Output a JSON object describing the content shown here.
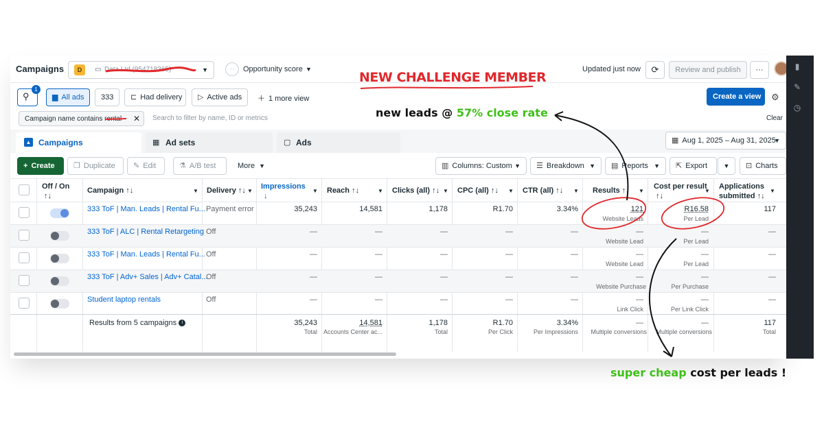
{
  "header": {
    "title": "Campaigns",
    "account_badge": "D",
    "account_name": "Data Ltd (954718365)",
    "opportunity_score": "Opportunity score",
    "updated": "Updated just now",
    "review_publish": "Review and publish",
    "more": "···"
  },
  "filters": {
    "search_badge": "1",
    "all_ads": "All ads",
    "view_333": "333",
    "had_delivery": "Had delivery",
    "active_ads": "Active ads",
    "more_view": "1 more view",
    "create_view": "Create a view",
    "chip_label": "Campaign name contains rental",
    "search_placeholder": "Search to filter by name, ID or metrics",
    "clear": "Clear"
  },
  "tabs": {
    "campaigns": "Campaigns",
    "adsets": "Ad sets",
    "ads": "Ads",
    "date_range": "Aug 1, 2025 – Aug 31, 2025"
  },
  "toolbar": {
    "create": "Create",
    "duplicate": "Duplicate",
    "edit": "Edit",
    "ab_test": "A/B test",
    "more": "More",
    "columns": "Columns: Custom",
    "breakdown": "Breakdown",
    "reports": "Reports",
    "export": "Export",
    "charts": "Charts"
  },
  "columns": {
    "offon": "Off / On",
    "offon_sort": "↑↓",
    "campaign": "Campaign ↑↓",
    "delivery": "Delivery ↑↓",
    "impressions": "Impressions",
    "impressions_sort": "↓",
    "reach": "Reach ↑↓",
    "clicks": "Clicks (all) ↑↓",
    "cpc": "CPC (all) ↑↓",
    "ctr": "CTR (all) ↑↓",
    "results": "Results ↑↓",
    "cpr": "Cost per result",
    "cpr_sort": "↑↓",
    "apps": "Applications",
    "apps2": "submitted ↑↓"
  },
  "rows": [
    {
      "name": "333 ToF | Man. Leads | Rental Fu...",
      "delivery": "Payment error",
      "impressions": "35,243",
      "reach": "14,581",
      "clicks": "1,178",
      "cpc": "R1.70",
      "ctr": "3.34%",
      "results": "121",
      "results_sub": "Website Leads",
      "cpr": "R16.58",
      "cpr_sub": "Per Lead",
      "apps": "117"
    },
    {
      "name": "333 ToF | ALC | Rental Retargeting",
      "delivery": "Off",
      "impressions": "—",
      "reach": "—",
      "clicks": "—",
      "cpc": "—",
      "ctr": "—",
      "results": "—",
      "results_sub": "Website Lead",
      "cpr": "—",
      "cpr_sub": "Per Lead",
      "apps": "—"
    },
    {
      "name": "333 ToF | Man. Leads | Rental Fu...",
      "delivery": "Off",
      "impressions": "—",
      "reach": "—",
      "clicks": "—",
      "cpc": "—",
      "ctr": "—",
      "results": "—",
      "results_sub": "Website Lead",
      "cpr": "—",
      "cpr_sub": "Per Lead",
      "apps": "—"
    },
    {
      "name": "333 ToF | Adv+ Sales | Adv+ Catal...",
      "delivery": "Off",
      "impressions": "—",
      "reach": "—",
      "clicks": "—",
      "cpc": "—",
      "ctr": "—",
      "results": "—",
      "results_sub": "Website Purchase",
      "cpr": "—",
      "cpr_sub": "Per Purchase",
      "apps": "—"
    },
    {
      "name": "Student laptop rentals",
      "delivery": "Off",
      "impressions": "—",
      "reach": "—",
      "clicks": "—",
      "cpc": "—",
      "ctr": "—",
      "results": "—",
      "results_sub": "Link Click",
      "cpr": "—",
      "cpr_sub": "Per Link Click",
      "apps": "—"
    }
  ],
  "totals": {
    "label": "Results from 5 campaigns",
    "impressions": "35,243",
    "impressions_sub": "Total",
    "reach": "14,581",
    "reach_sub": "Accounts Center ac...",
    "clicks": "1,178",
    "clicks_sub": "Total",
    "cpc": "R1.70",
    "cpc_sub": "Per Click",
    "ctr": "3.34%",
    "ctr_sub": "Per Impressions",
    "results": "—",
    "results_sub": "Multiple conversions",
    "cpr": "—",
    "cpr_sub": "Multiple conversions",
    "apps": "117",
    "apps_sub": "Total"
  },
  "annotations": {
    "challenge": "NEW CHALLENGE MEMBER",
    "leads_prefix": "new leads @ ",
    "leads_rate": "57% close rate",
    "cheap_prefix": "super cheap",
    "cheap_suffix": " cost per leads !"
  },
  "colors": {
    "primary_blue": "#0a66c2",
    "create_green": "#166534",
    "annotation_red": "#e0282c",
    "annotation_green": "#3fbf1a",
    "toggle_on": "#5b8de0"
  }
}
